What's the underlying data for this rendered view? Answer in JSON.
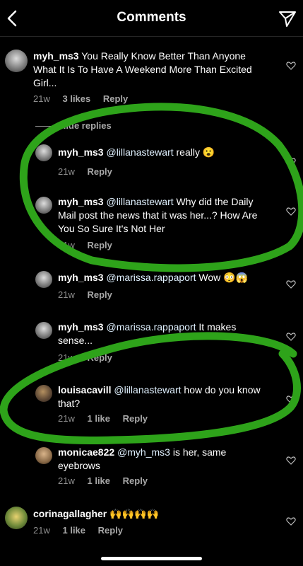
{
  "header": {
    "title": "Comments"
  },
  "colors": {
    "background": "#000000",
    "meta": "#8e8e8e",
    "annotation": "#2ea31a"
  },
  "icons": {
    "back": "chevron-left-icon",
    "send": "paper-plane-icon",
    "like": "heart-outline-icon"
  },
  "main_comment": {
    "username": "myh_ms3",
    "text": "You Really Know Better Than Anyone What It Is To Have A Weekend More Than Excited Girl...",
    "time": "21w",
    "likes": "3 likes",
    "reply": "Reply"
  },
  "hide_replies": "Hide replies",
  "replies": [
    {
      "username": "myh_ms3",
      "mention": "@lillanastewart",
      "text": "really 😮",
      "time": "21w",
      "likes": "",
      "reply": "Reply"
    },
    {
      "username": "myh_ms3",
      "mention": "@lillanastewart",
      "text": "Why did the Daily Mail post the news that it was her...? How Are You So Sure It's Not Her",
      "time": "21w",
      "likes": "",
      "reply": "Reply"
    },
    {
      "username": "myh_ms3",
      "mention": "@marissa.rappaport",
      "text": "Wow 😳😱",
      "time": "21w",
      "likes": "",
      "reply": "Reply"
    },
    {
      "username": "myh_ms3",
      "mention": "@marissa.rappaport",
      "text": "It makes sense...",
      "time": "21w",
      "likes": "",
      "reply": "Reply"
    },
    {
      "username": "louisacavill",
      "mention": "@lillanastewart",
      "text": "how  do you know that?",
      "time": "21w",
      "likes": "1 like",
      "reply": "Reply"
    },
    {
      "username": "monicae822",
      "mention": "@myh_ms3",
      "text": "is her, same eyebrows",
      "time": "21w",
      "likes": "1 like",
      "reply": "Reply"
    }
  ],
  "last_comment": {
    "username": "corinagallagher",
    "text": "🙌🙌🙌🙌",
    "time": "21w",
    "likes": "1 like",
    "reply": "Reply"
  }
}
